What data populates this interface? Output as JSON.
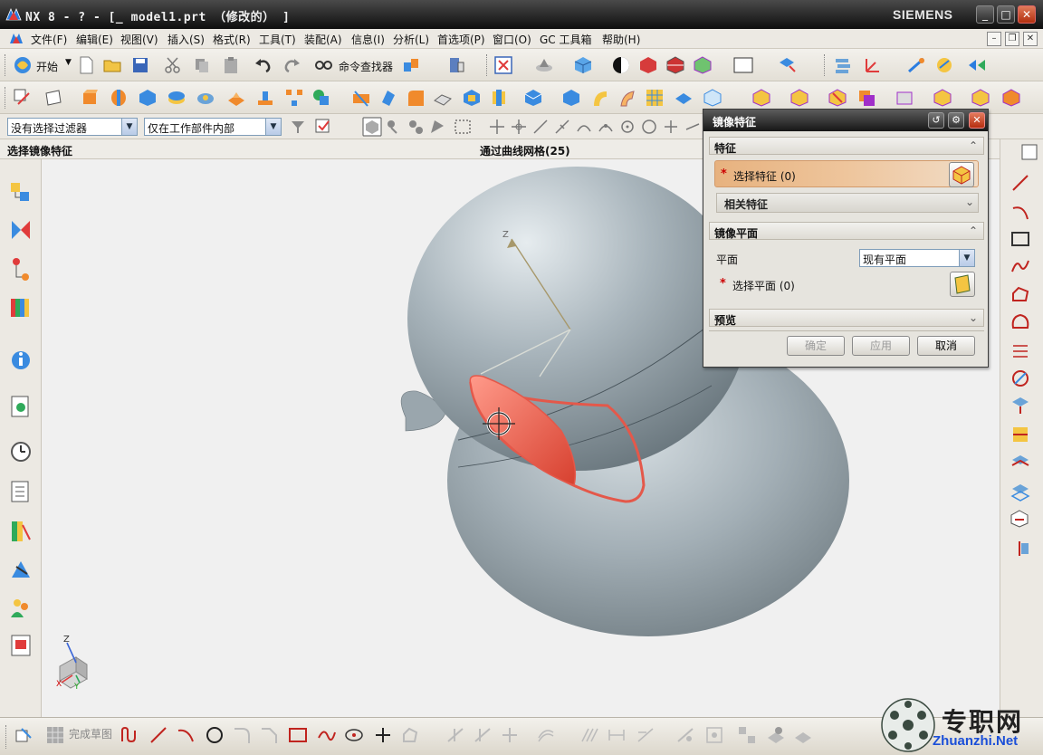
{
  "window": {
    "title": "NX 8 - ? - [_ model1.prt （修改的） ]",
    "brand": "SIEMENS",
    "buttons": [
      "_",
      "□",
      "✕"
    ]
  },
  "menu": {
    "items": [
      "文件(F)",
      "编辑(E)",
      "视图(V)",
      "插入(S)",
      "格式(R)",
      "工具(T)",
      "装配(A)",
      "信息(I)",
      "分析(L)",
      "首选项(P)",
      "窗口(O)",
      "GC 工具箱",
      "帮助(H)"
    ]
  },
  "toolbar": {
    "start_label": "开始",
    "command_finder_label": "命令查找器"
  },
  "selection_bar": {
    "filter_value": "没有选择过滤器",
    "scope_value": "仅在工作部件内部"
  },
  "cue_line": {
    "prompt": "选择镜像特征",
    "status": "通过曲线网格(25)"
  },
  "bottom_toolbar": {
    "finish_sketch_label": "完成草图"
  },
  "dialog": {
    "title": "镜像特征",
    "group_feature": {
      "label": "特征",
      "select_feature": "选择特征 (0)",
      "related_features": "相关特征"
    },
    "group_mirror_plane": {
      "label": "镜像平面",
      "plane_label": "平面",
      "plane_option": "现有平面",
      "select_plane": "选择平面 (0)"
    },
    "group_preview": {
      "label": "预览"
    },
    "buttons": {
      "ok": "确定",
      "apply": "应用",
      "cancel": "取消"
    }
  },
  "viewport": {
    "axis_label_z": "Z",
    "triad_z": "Z",
    "triad_x": "X",
    "triad_y": "Y",
    "model_color": "#a9b5bc",
    "highlight_color": "#e4584a"
  },
  "watermark": {
    "cn": "专职网",
    "en": "Zhuanzhi.Net"
  }
}
